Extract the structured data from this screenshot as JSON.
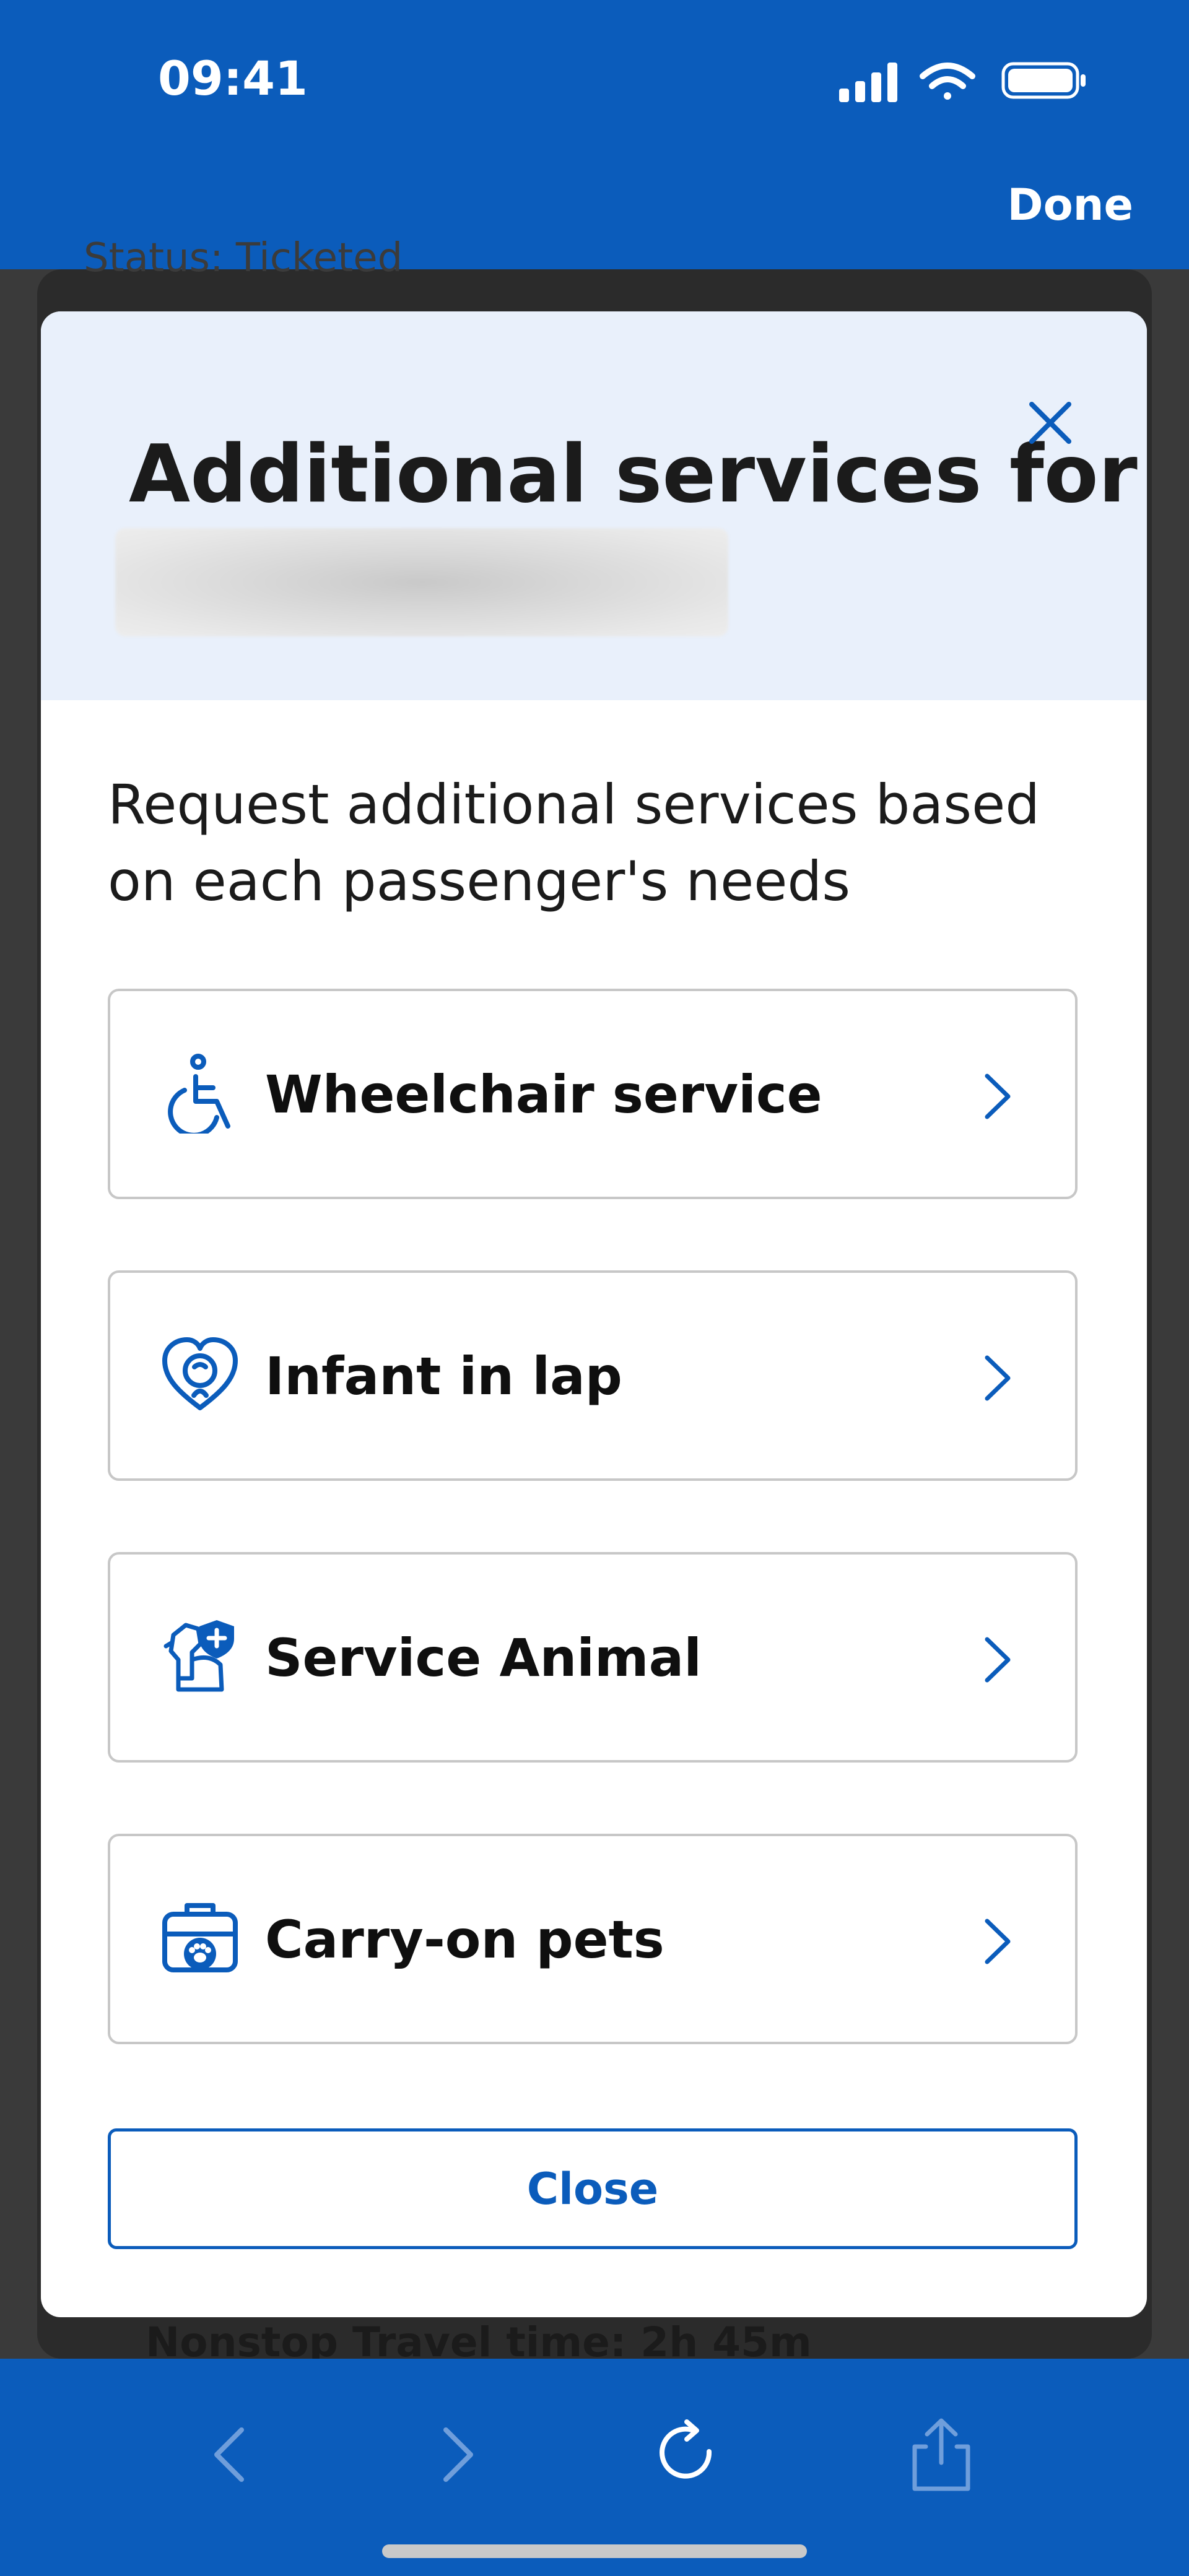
{
  "status_bar": {
    "time": "09:41",
    "done_label": "Done"
  },
  "background": {
    "top_text": "Status: Ticketed",
    "bottom_text": "Nonstop   Travel time: 2h 45m"
  },
  "modal": {
    "title": "Additional services for",
    "intro": "Request additional services based on each passenger's needs",
    "options": [
      {
        "label": "Wheelchair service",
        "icon": "wheelchair-icon"
      },
      {
        "label": "Infant in lap",
        "icon": "infant-heart-icon"
      },
      {
        "label": "Service Animal",
        "icon": "service-animal-icon"
      },
      {
        "label": "Carry-on pets",
        "icon": "pet-carrier-icon"
      }
    ],
    "close_label": "Close"
  },
  "toolbar": {
    "items": [
      "back-icon",
      "forward-icon",
      "reload-icon",
      "share-icon"
    ]
  },
  "colors": {
    "brand": "#0b5cbb",
    "header_bg": "#e9f0fb",
    "text": "#1b1b1b",
    "border": "#c7c7c7"
  }
}
